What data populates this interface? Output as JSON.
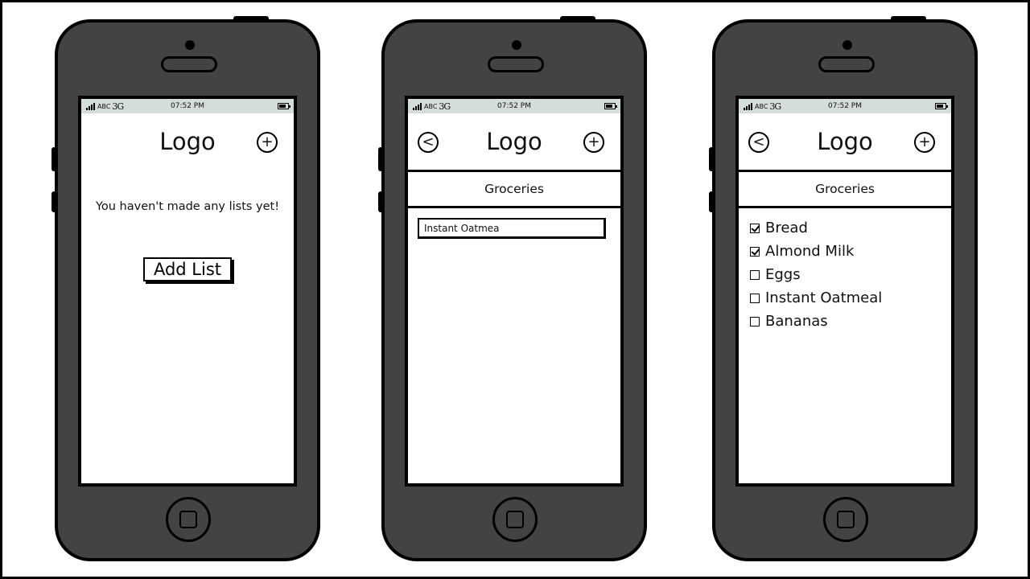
{
  "status_bar": {
    "carrier": "ABC",
    "network": "3G",
    "time": "07:52 PM"
  },
  "icons": {
    "signal": "signal-bars-icon",
    "battery": "battery-icon",
    "back": "back-circle-icon",
    "add": "add-circle-icon",
    "home": "home-button-icon"
  },
  "screens": [
    {
      "logo": "Logo",
      "add_symbol": "+",
      "empty_message": "You haven't made any lists yet!",
      "add_list_label": "Add List"
    },
    {
      "logo": "Logo",
      "back_symbol": "<",
      "add_symbol": "+",
      "list_title": "Groceries",
      "input_value": "Instant Oatmea"
    },
    {
      "logo": "Logo",
      "back_symbol": "<",
      "add_symbol": "+",
      "list_title": "Groceries",
      "items": [
        {
          "label": "Bread",
          "checked": true
        },
        {
          "label": "Almond Milk",
          "checked": true
        },
        {
          "label": "Eggs",
          "checked": false
        },
        {
          "label": "Instant Oatmeal",
          "checked": false
        },
        {
          "label": "Bananas",
          "checked": false
        }
      ]
    }
  ]
}
